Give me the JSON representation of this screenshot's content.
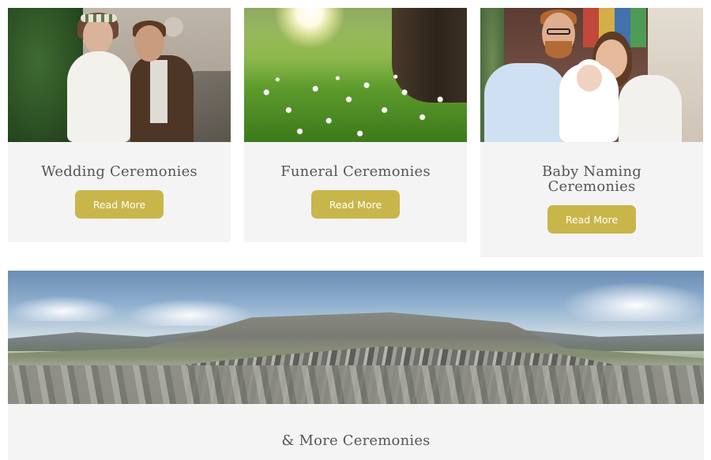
{
  "cards": [
    {
      "title": "Wedding Ceremonies",
      "button": "Read More",
      "image": "wedding-couple-photo"
    },
    {
      "title": "Funeral Ceremonies",
      "button": "Read More",
      "image": "sunlit-meadow-photo"
    },
    {
      "title": "Baby Naming Ceremonies",
      "button": "Read More",
      "image": "family-with-baby-photo"
    }
  ],
  "banner": {
    "title": "& More Ceremonies",
    "image": "limestone-landscape-photo"
  },
  "colors": {
    "button_bg": "#c9b64a",
    "button_text": "#ffffff",
    "card_bg": "#f4f4f4",
    "title_text": "#555555"
  }
}
